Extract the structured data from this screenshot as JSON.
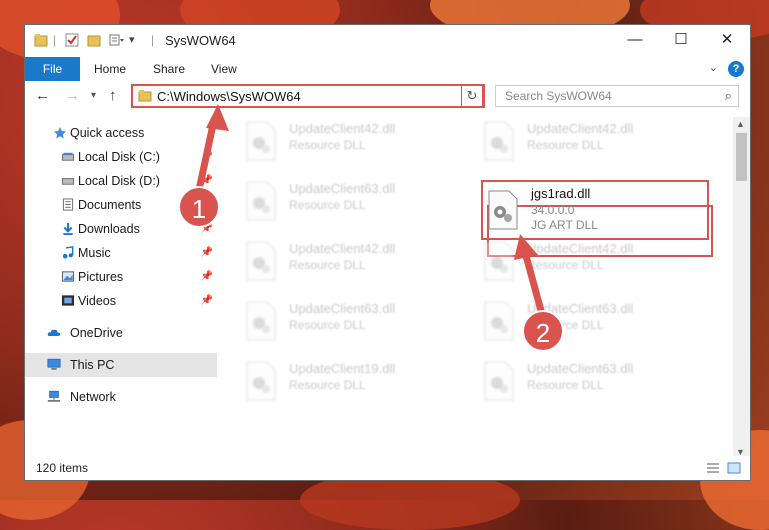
{
  "window": {
    "title": "SysWOW64",
    "controls": {
      "minimize": "—",
      "maximize": "☐",
      "close": "✕"
    }
  },
  "ribbon": {
    "file": "File",
    "tabs": [
      "Home",
      "Share",
      "View"
    ],
    "help": "?"
  },
  "navigation": {
    "address": "C:\\Windows\\SysWOW64",
    "search_placeholder": "Search SysWOW64"
  },
  "sidebar": {
    "items": [
      {
        "label": "Quick access",
        "icon": "star-icon"
      },
      {
        "label": "Local Disk (C:)",
        "icon": "drive-icon"
      },
      {
        "label": "Local Disk (D:)",
        "icon": "drive-icon"
      },
      {
        "label": "Documents",
        "icon": "documents-icon"
      },
      {
        "label": "Downloads",
        "icon": "download-icon"
      },
      {
        "label": "Music",
        "icon": "music-icon"
      },
      {
        "label": "Pictures",
        "icon": "pictures-icon"
      },
      {
        "label": "Videos",
        "icon": "videos-icon"
      },
      {
        "label": "OneDrive",
        "icon": "cloud-icon"
      },
      {
        "label": "This PC",
        "icon": "computer-icon"
      },
      {
        "label": "Network",
        "icon": "network-icon"
      }
    ]
  },
  "files": [
    {
      "name": "UpdateClient42.dll",
      "desc": "Resource DLL"
    },
    {
      "name": "UpdateClient42.dll",
      "desc": "Resource DLL"
    },
    {
      "name": "UpdateClient63.dll",
      "desc": "Resource DLL"
    },
    {
      "name": "jgs1rad.dll",
      "version": "34.0.0.0",
      "desc": "JG ART DLL"
    },
    {
      "name": "UpdateClient42.dll",
      "desc": "Resource DLL"
    },
    {
      "name": "UpdateClient42.dll",
      "desc": "Resource DLL"
    },
    {
      "name": "UpdateClient63.dll",
      "desc": "Resource DLL"
    },
    {
      "name": "UpdateClient63.dll",
      "desc": "Resource DLL"
    },
    {
      "name": "UpdateClient19.dll",
      "desc": "Resource DLL"
    },
    {
      "name": "UpdateClient63.dll",
      "desc": "Resource DLL"
    }
  ],
  "status": {
    "item_count": "120 items"
  },
  "annotations": {
    "step1": "1",
    "step2": "2"
  },
  "colors": {
    "accent": "#1979ca",
    "highlight": "#d9534f"
  }
}
